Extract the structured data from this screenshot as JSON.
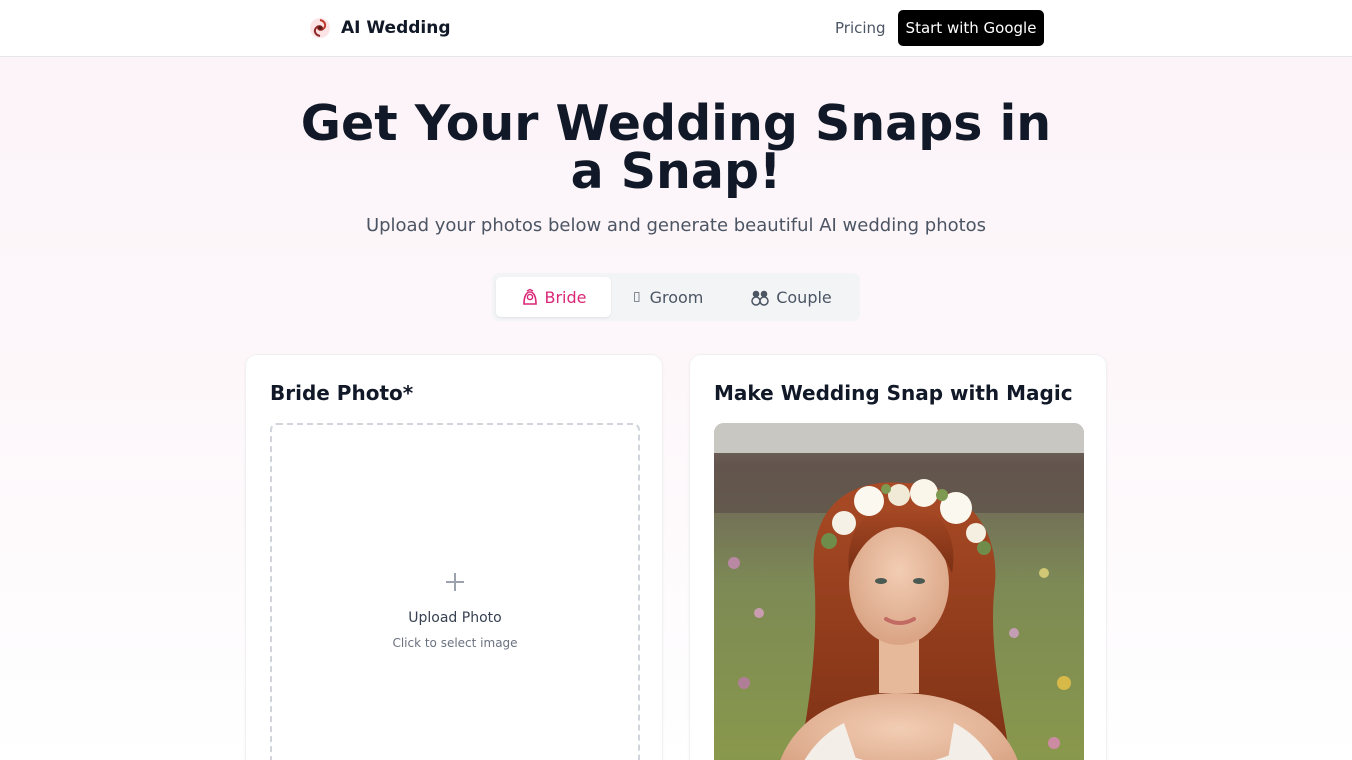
{
  "header": {
    "brand": "AI Wedding",
    "nav_pricing": "Pricing",
    "cta": "Start with Google"
  },
  "hero": {
    "title": "Get Your Wedding Snaps in a Snap!",
    "subtitle": "Upload your photos below and generate beautiful AI wedding photos"
  },
  "tabs": [
    {
      "label": "Bride",
      "icon": "bride-icon",
      "active": true
    },
    {
      "label": "Groom",
      "icon": "groom-icon",
      "active": false
    },
    {
      "label": "Couple",
      "icon": "couple-icon",
      "active": false
    }
  ],
  "upload_card": {
    "title": "Bride Photo*",
    "upload_label": "Upload Photo",
    "upload_hint": "Click to select image"
  },
  "preview_card": {
    "title": "Make Wedding Snap with Magic"
  },
  "colors": {
    "accent": "#db2777",
    "cta_bg": "#000000"
  }
}
